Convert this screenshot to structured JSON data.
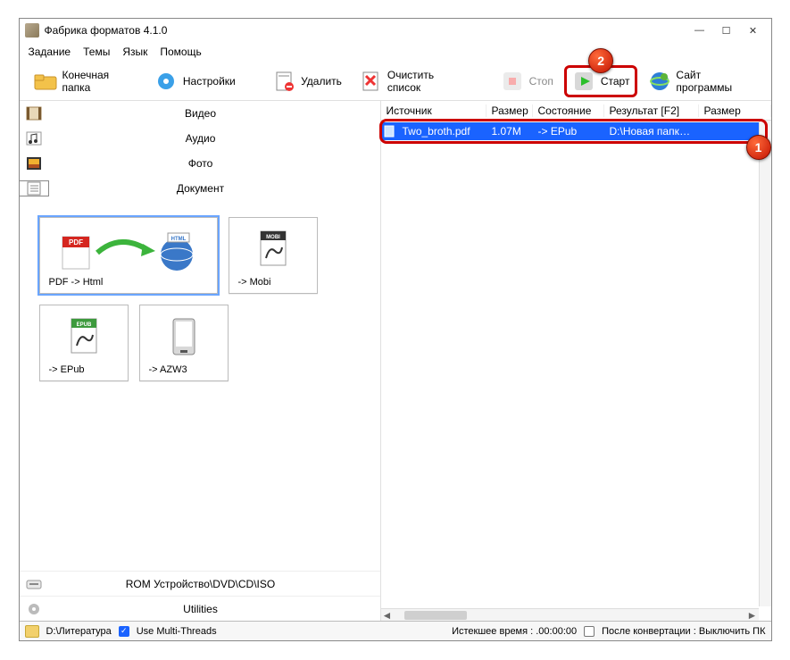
{
  "window": {
    "title": "Фабрика форматов 4.1.0"
  },
  "menu": [
    "Задание",
    "Темы",
    "Язык",
    "Помощь"
  ],
  "toolbar": {
    "output_folder": "Конечная папка",
    "settings": "Настройки",
    "delete": "Удалить",
    "clear_list": "Очистить список",
    "stop": "Стоп",
    "start": "Старт",
    "site": "Сайт программы"
  },
  "categories": {
    "video": "Видео",
    "audio": "Аудио",
    "photo": "Фото",
    "document": "Документ"
  },
  "conversions": {
    "pdf_html": "PDF -> Html",
    "mobi": "-> Mobi",
    "epub": "-> EPub",
    "azw3": "-> AZW3"
  },
  "sidebar_bottom": {
    "rom": "ROM Устройство\\DVD\\CD\\ISO",
    "utilities": "Utilities"
  },
  "columns": {
    "source": "Источник",
    "size": "Размер",
    "state": "Состояние",
    "result": "Результат [F2]",
    "size2": "Размер"
  },
  "row": {
    "file": "Two_broth.pdf",
    "size": "1.07M",
    "state": "-> EPub",
    "result": "D:\\Новая папка..."
  },
  "callouts": {
    "one": "1",
    "two": "2"
  },
  "status": {
    "path": "D:\\Литература",
    "multithreads": "Use Multi-Threads",
    "elapsed": "Истекшее время : .00:00:00",
    "after": "После конвертации : Выключить ПК"
  }
}
